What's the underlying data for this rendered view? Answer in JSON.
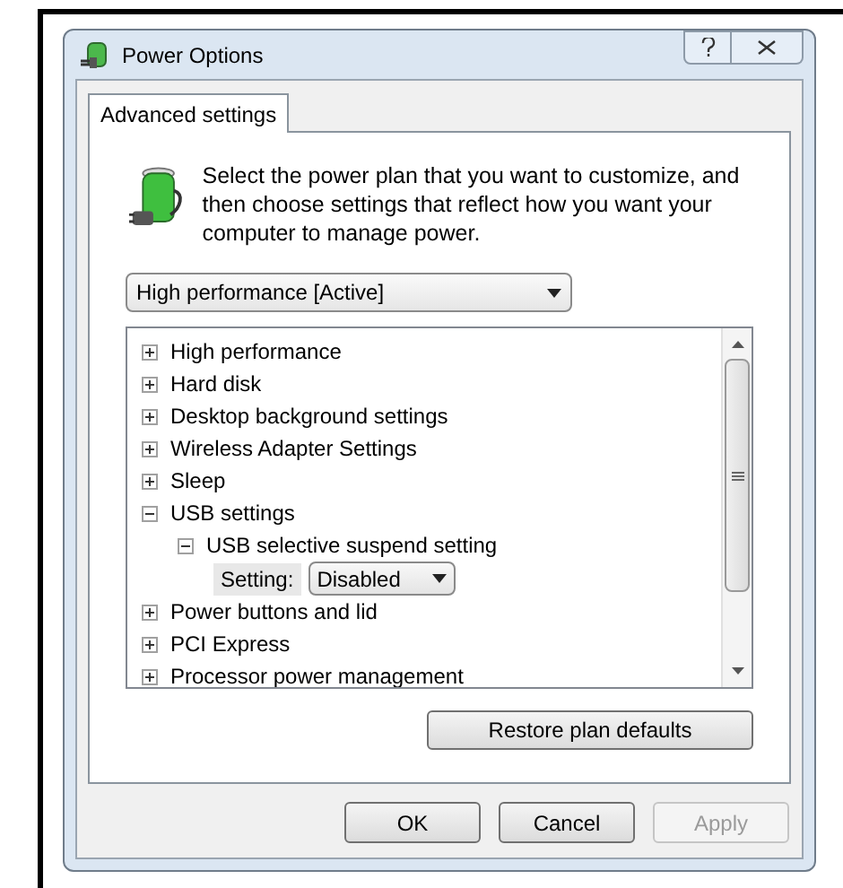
{
  "window": {
    "title": "Power Options"
  },
  "tabs": [
    {
      "label": "Advanced settings",
      "selected": true
    }
  ],
  "intro": "Select the power plan that you want to customize, and then choose settings that reflect how you want your computer to manage power.",
  "plan_dropdown": {
    "value": "High performance [Active]"
  },
  "settings_tree": [
    {
      "kind": "group",
      "label": "High performance",
      "expanded": false
    },
    {
      "kind": "group",
      "label": "Hard disk",
      "expanded": false
    },
    {
      "kind": "group",
      "label": "Desktop background settings",
      "expanded": false
    },
    {
      "kind": "group",
      "label": "Wireless Adapter Settings",
      "expanded": false
    },
    {
      "kind": "group",
      "label": "Sleep",
      "expanded": false
    },
    {
      "kind": "group",
      "label": "USB settings",
      "expanded": true,
      "children": [
        {
          "kind": "group",
          "label": "USB selective suspend setting",
          "expanded": true,
          "children": [
            {
              "kind": "setting",
              "label": "Setting:",
              "value": "Disabled"
            }
          ]
        }
      ]
    },
    {
      "kind": "group",
      "label": "Power buttons and lid",
      "expanded": false
    },
    {
      "kind": "group",
      "label": "PCI Express",
      "expanded": false
    },
    {
      "kind": "group",
      "label": "Processor power management",
      "expanded": false
    }
  ],
  "restore_button": "Restore plan defaults",
  "buttons": [
    {
      "label": "OK",
      "disabled": false
    },
    {
      "label": "Cancel",
      "disabled": false
    },
    {
      "label": "Apply",
      "disabled": true
    }
  ]
}
